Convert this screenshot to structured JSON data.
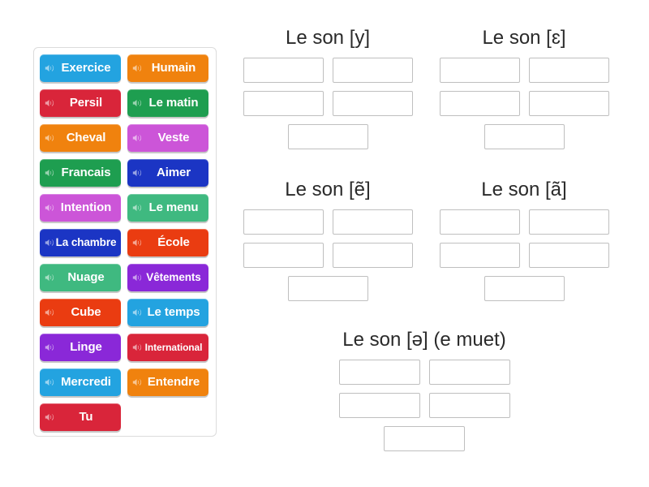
{
  "activity": {
    "type": "group-sort",
    "icon_name": "speaker-icon"
  },
  "tile_panel": {
    "name": "word-tile-bank",
    "tiles": [
      {
        "label": "Exercice",
        "color": "#23a3e0",
        "size": "normal"
      },
      {
        "label": "Humain",
        "color": "#f0820e",
        "size": "normal"
      },
      {
        "label": "Persil",
        "color": "#d9253a",
        "size": "normal"
      },
      {
        "label": "Le matin",
        "color": "#1e9e50",
        "size": "normal"
      },
      {
        "label": "Cheval",
        "color": "#f0820e",
        "size": "normal"
      },
      {
        "label": "Veste",
        "color": "#cc55d8",
        "size": "normal"
      },
      {
        "label": "Francais",
        "color": "#1e9e50",
        "size": "normal"
      },
      {
        "label": "Aimer",
        "color": "#1b35c4",
        "size": "normal"
      },
      {
        "label": "Intention",
        "color": "#cc55d8",
        "size": "normal"
      },
      {
        "label": "Le menu",
        "color": "#3fb980",
        "size": "normal"
      },
      {
        "label": "La chambre",
        "color": "#1b35c4",
        "size": "medium"
      },
      {
        "label": "École",
        "color": "#ea3c11",
        "size": "normal"
      },
      {
        "label": "Nuage",
        "color": "#3fb980",
        "size": "normal"
      },
      {
        "label": "Vêtements",
        "color": "#8a28d8",
        "size": "medium"
      },
      {
        "label": "Cube",
        "color": "#ea3c11",
        "size": "normal"
      },
      {
        "label": "Le temps",
        "color": "#23a3e0",
        "size": "normal"
      },
      {
        "label": "Linge",
        "color": "#8a28d8",
        "size": "normal"
      },
      {
        "label": "International",
        "color": "#d9253a",
        "size": "small"
      },
      {
        "label": "Mercredi",
        "color": "#23a3e0",
        "size": "normal"
      },
      {
        "label": "Entendre",
        "color": "#f0820e",
        "size": "normal"
      },
      {
        "label": "Tu",
        "color": "#d9253a",
        "size": "normal"
      }
    ]
  },
  "categories": [
    {
      "id": "son-y",
      "title": "Le son [y]",
      "zone_count": 5,
      "zones": [
        "",
        "",
        "",
        "",
        ""
      ]
    },
    {
      "id": "son-epsilon",
      "title": "Le son [ɛ]",
      "zone_count": 5,
      "zones": [
        "",
        "",
        "",
        "",
        ""
      ]
    },
    {
      "id": "son-e-nasal",
      "title": "Le son [ẽ]",
      "zone_count": 5,
      "zones": [
        "",
        "",
        "",
        "",
        ""
      ]
    },
    {
      "id": "son-a-nasal",
      "title": "Le son [ã]",
      "zone_count": 5,
      "zones": [
        "",
        "",
        "",
        "",
        ""
      ]
    },
    {
      "id": "son-schwa",
      "title": "Le son [ə] (e muet)",
      "zone_count": 5,
      "zones": [
        "",
        "",
        "",
        "",
        ""
      ]
    }
  ],
  "colors": {
    "page_background": "#ffffff",
    "panel_border": "#dcdcdc",
    "zone_border": "#bfbfbf",
    "title_text": "#2a2a2a",
    "tile_text": "#ffffff"
  }
}
